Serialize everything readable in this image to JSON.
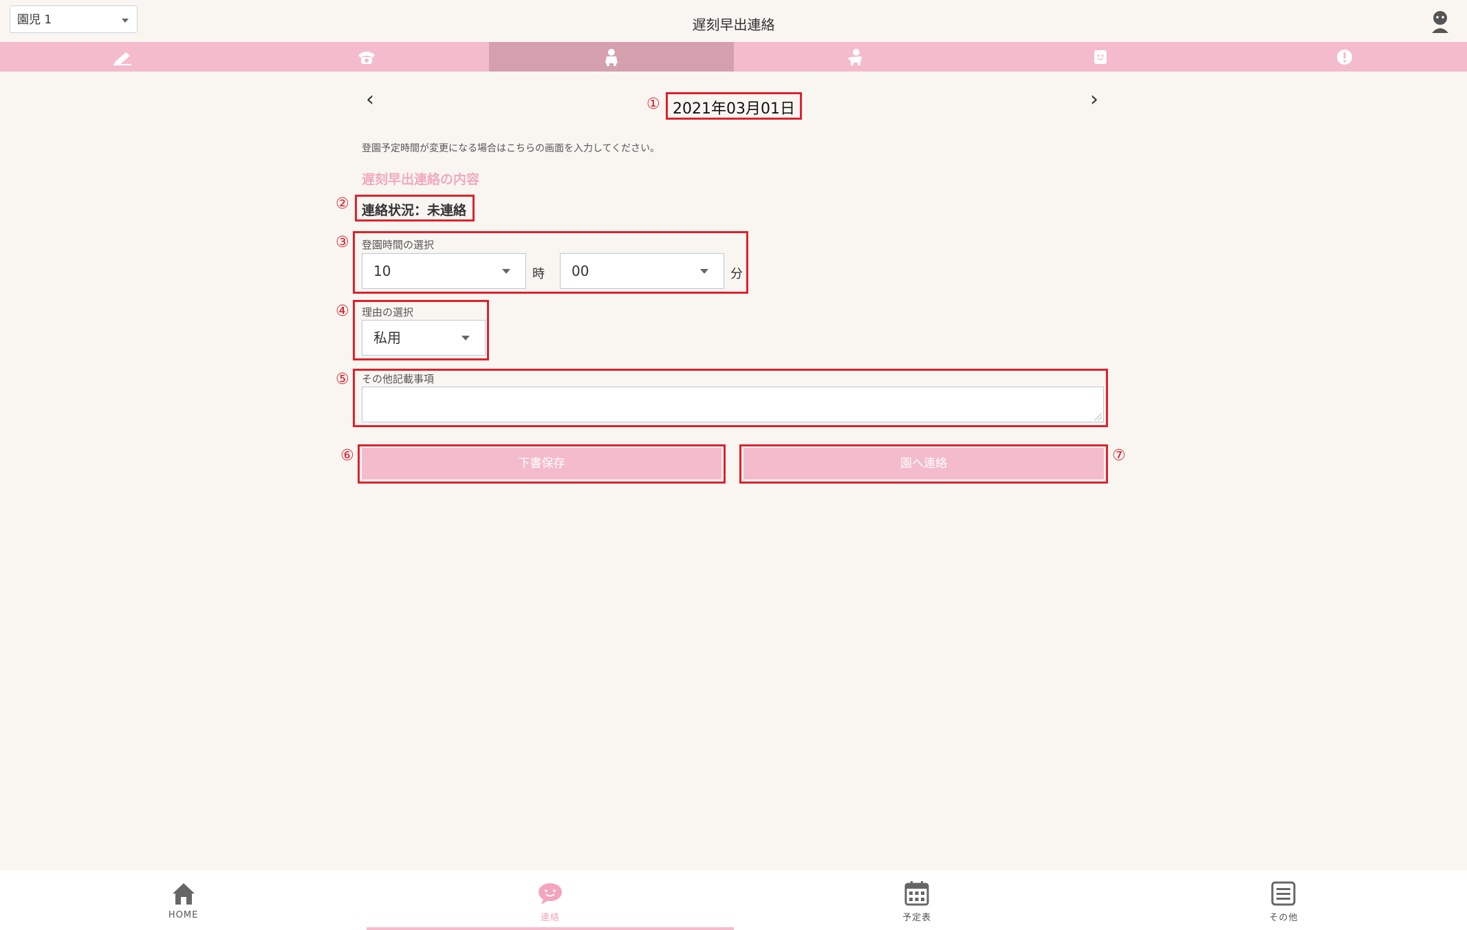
{
  "header": {
    "child_select": "園児 1",
    "title": "遅刻早出連絡"
  },
  "tabs": [
    {
      "icon": "pencil-icon",
      "active": false
    },
    {
      "icon": "phone-icon",
      "active": false
    },
    {
      "icon": "child-walking-icon",
      "active": true
    },
    {
      "icon": "child-running-icon",
      "active": false
    },
    {
      "icon": "face-card-icon",
      "active": false
    },
    {
      "icon": "alert-icon",
      "active": false
    }
  ],
  "date_nav": {
    "prev": "‹",
    "next": "›",
    "date": "2021年03月01日"
  },
  "markers": [
    "①",
    "②",
    "③",
    "④",
    "⑤",
    "⑥",
    "⑦"
  ],
  "form": {
    "intro": "登園予定時間が変更になる場合はこちらの画面を入力してください。",
    "section_title": "遅刻早出連絡の内容",
    "status": "連絡状況：未連絡",
    "arrival_time_label": "登園時間の選択",
    "hour_value": "10",
    "hour_unit": "時",
    "minute_value": "00",
    "minute_unit": "分",
    "reason_label": "理由の選択",
    "reason_value": "私用",
    "notes_label": "その他記載事項",
    "notes_value": "",
    "save_draft_button": "下書保存",
    "send_button": "園へ連絡"
  },
  "bottom_nav": [
    {
      "label": "HOME",
      "icon": "home-icon",
      "active": false
    },
    {
      "label": "連絡",
      "icon": "chat-bubble-icon",
      "active": true
    },
    {
      "label": "予定表",
      "icon": "calendar-icon",
      "active": false
    },
    {
      "label": "その他",
      "icon": "menu-list-icon",
      "active": false
    }
  ],
  "colors": {
    "background": "#f9f6f2",
    "accent_pink": "#f4bbcd",
    "active_tab": "#d4a0ae",
    "annotation_red": "#e0202a"
  }
}
